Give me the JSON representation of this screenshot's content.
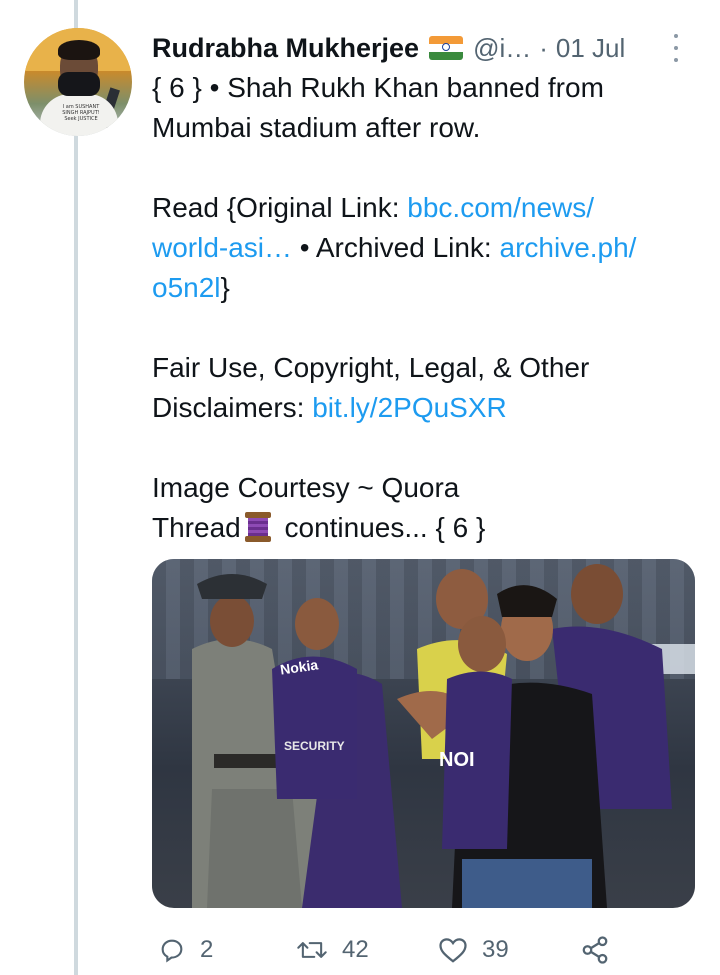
{
  "tweet": {
    "author_name": "Rudrabha Mukherjee",
    "handle": "@i…",
    "separator": "·",
    "date": "01 Jul",
    "avatar_shirt_text": "I am SUSHANT SINGH RAJPUT! Seek JUSTICE",
    "lines": {
      "l1": "{ 6 } • Shah Rukh Khan banned from",
      "l2": "Mumbai stadium after row.",
      "read_prefix": "Read {Original Link: ",
      "link1a": "bbc.com/news/",
      "link1b": "world-asi…",
      "archived_prefix": " • Archived Link: ",
      "link2a": "archive.ph/",
      "link2b": "o5n2l",
      "close_brace": "}",
      "disc1": "Fair Use, Copyright, Legal, & Other",
      "disc2_prefix": "Disclaimers: ",
      "disc_link": "bit.ly/2PQuSXR",
      "courtesy": "Image Courtesy ~ Quora",
      "thread_prefix": "Thread",
      "thread_suffix": " continues... { 6 }"
    },
    "media": {
      "jersey_text": "NOI",
      "sponsor_text": "Nokia",
      "security_text": "SECURITY"
    },
    "actions": {
      "replies": "2",
      "retweets": "42",
      "likes": "39"
    },
    "colors": {
      "link": "#1d9bf0",
      "muted": "#536471",
      "text": "#0f1419"
    }
  }
}
